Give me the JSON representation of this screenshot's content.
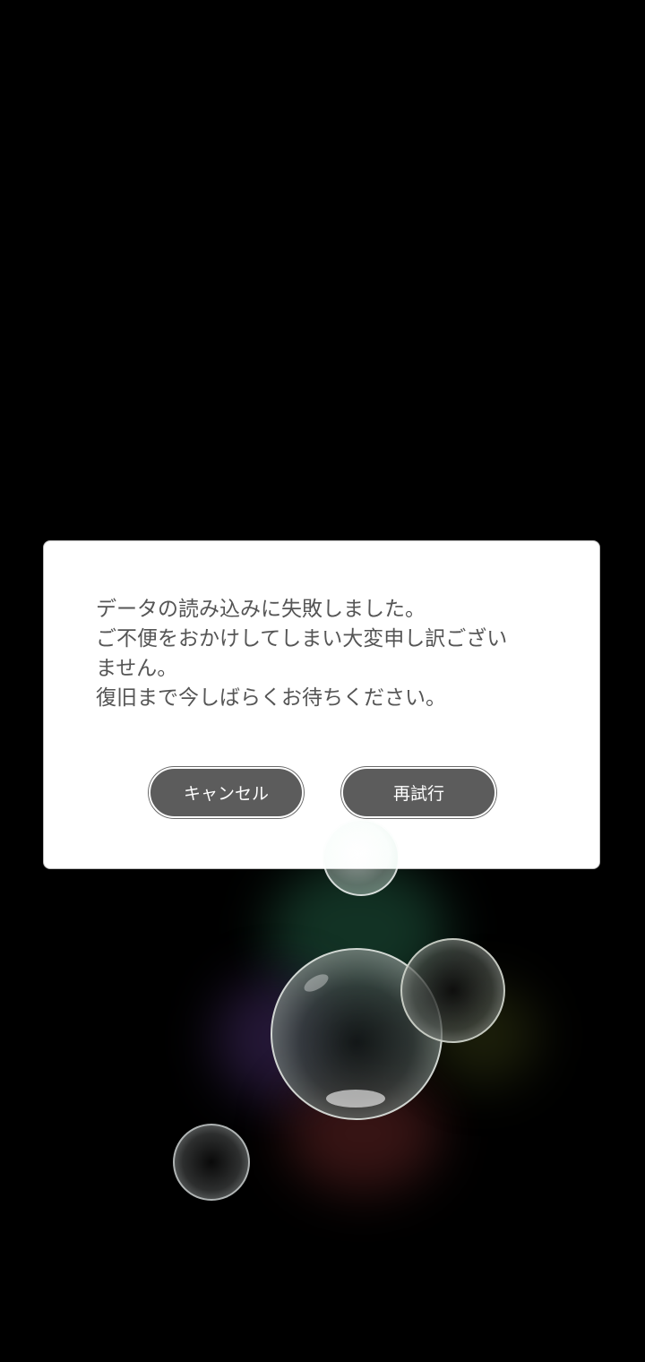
{
  "dialog": {
    "message_lines": [
      "データの読み込みに失敗しました。",
      "ご不便をおかけしてしまい大変申し訳ござい",
      "ません。",
      "復旧まで今しばらくお待ちください。"
    ],
    "cancel_label": "キャンセル",
    "retry_label": "再試行"
  },
  "colors": {
    "background": "#000000",
    "dialog_background": "#ffffff",
    "message_text": "#555555",
    "button_fill": "#5c5c5c",
    "button_text": "#ffffff"
  }
}
